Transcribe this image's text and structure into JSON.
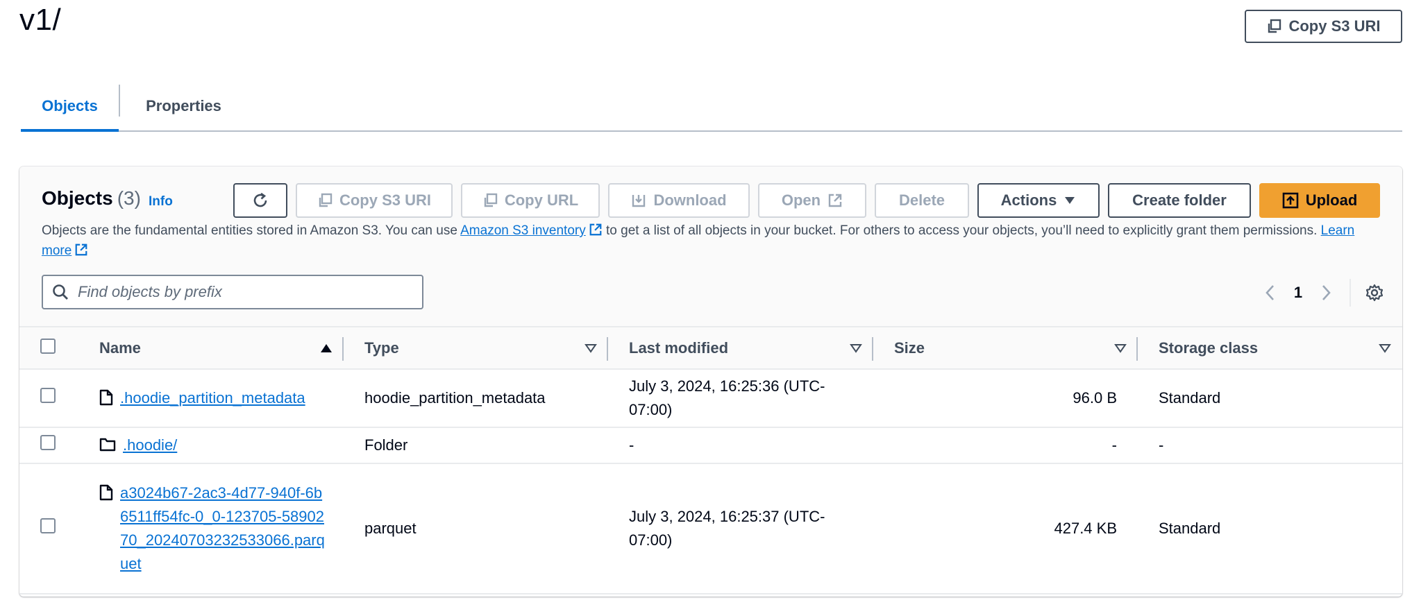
{
  "header": {
    "title": "v1/",
    "copy_s3_uri_label": "Copy S3 URI"
  },
  "tabs": [
    {
      "label": "Objects",
      "active": true
    },
    {
      "label": "Properties",
      "active": false
    }
  ],
  "objects_panel": {
    "title": "Objects",
    "count": "(3)",
    "info_label": "Info",
    "buttons": {
      "refresh": "refresh-icon",
      "copy_s3_uri": "Copy S3 URI",
      "copy_url": "Copy URL",
      "download": "Download",
      "open": "Open",
      "delete": "Delete",
      "actions": "Actions",
      "create_folder": "Create folder",
      "upload": "Upload"
    },
    "description": {
      "part1": "Objects are the fundamental entities stored in Amazon S3. You can use ",
      "inventory_link": "Amazon S3 inventory",
      "part2": " to get a list of all objects in your bucket. For others to access your objects, you’ll need to explicitly grant them permissions. ",
      "learn_more_link": "Learn more"
    },
    "search": {
      "placeholder": "Find objects by prefix",
      "value": ""
    },
    "pagination": {
      "current_page": "1"
    }
  },
  "table": {
    "columns": [
      {
        "label": "Name",
        "sort": "ascending"
      },
      {
        "label": "Type",
        "sort": "none"
      },
      {
        "label": "Last modified",
        "sort": "none"
      },
      {
        "label": "Size",
        "sort": "none"
      },
      {
        "label": "Storage class",
        "sort": "none"
      }
    ],
    "rows": [
      {
        "icon": "file-icon",
        "name": ".hoodie_partition_metadata",
        "type": "hoodie_partition_metadata",
        "last_modified": "July 3, 2024, 16:25:36 (UTC-07:00)",
        "size": "96.0 B",
        "storage_class": "Standard"
      },
      {
        "icon": "folder-icon",
        "name": ".hoodie/",
        "type": "Folder",
        "last_modified": "-",
        "size": "-",
        "storage_class": "-"
      },
      {
        "icon": "file-icon",
        "name": "a3024b67-2ac3-4d77-940f-6b6511ff54fc-0_0-123705-5890270_20240703232533066.parquet",
        "type": "parquet",
        "last_modified": "July 3, 2024, 16:25:37 (UTC-07:00)",
        "size": "427.4 KB",
        "storage_class": "Standard"
      }
    ]
  },
  "colors": {
    "link": "#0972d3",
    "primary_button": "#f0a030",
    "text": "#000716",
    "muted": "#414d5c",
    "disabled": "#9ba7b6"
  }
}
